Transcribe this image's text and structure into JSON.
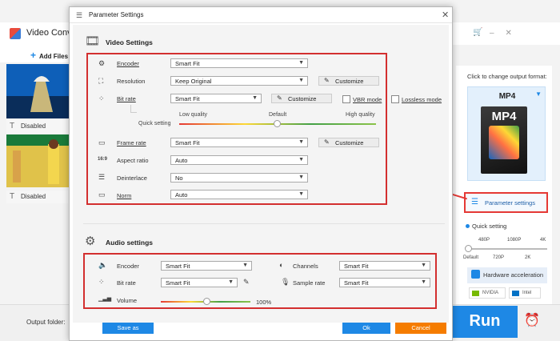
{
  "app": {
    "title": "Video Conve",
    "add_files_label": "Add Files",
    "disabled_label": "Disabled",
    "output_folder_label": "Output folder:",
    "run_label": "Run",
    "change_format_label": "Click to change output format:",
    "format": "MP4",
    "param_settings_label": "Parameter settings",
    "quick_setting_label": "Quick setting",
    "quality_top": [
      "480P",
      "1080P",
      "4K"
    ],
    "quality_bottom": [
      "Default",
      "720P",
      "2K"
    ],
    "hw_accel_label": "Hardware acceleration",
    "chips": [
      "NVIDIA",
      "Intel"
    ]
  },
  "dialog": {
    "title": "Parameter Settings",
    "video_section_title": "Video Settings",
    "audio_section_title": "Audio settings",
    "video": {
      "encoder_label": "Encoder",
      "encoder_value": "Smart Fit",
      "resolution_label": "Resolution",
      "resolution_value": "Keep Original",
      "bitrate_label": "Bit rate",
      "bitrate_value": "Smart Fit",
      "vbr_label": "VBR mode",
      "lossless_label": "Lossless mode",
      "quick_setting_label": "Quick setting",
      "low_quality": "Low quality",
      "default_quality": "Default",
      "high_quality": "High quality",
      "framerate_label": "Frame rate",
      "framerate_value": "Smart Fit",
      "aspect_label": "Aspect ratio",
      "aspect_value": "Auto",
      "aspect_icon_text": "16:9",
      "deinterlace_label": "Deinterlace",
      "deinterlace_value": "No",
      "norm_label": "Norm",
      "norm_value": "Auto",
      "customize_label": "Customize"
    },
    "audio": {
      "encoder_label": "Encoder",
      "encoder_value": "Smart Fit",
      "bitrate_label": "Bit rate",
      "bitrate_value": "Smart Fit",
      "volume_label": "Volume",
      "volume_value": "100%",
      "channels_label": "Channels",
      "channels_value": "Smart Fit",
      "samplerate_label": "Sample rate",
      "samplerate_value": "Smart Fit"
    },
    "save_as_label": "Save as",
    "ok_label": "Ok",
    "cancel_label": "Cancel"
  },
  "colors": {
    "accent": "#1e88e5",
    "highlight": "#d32f2f",
    "cancel": "#f57c00"
  }
}
